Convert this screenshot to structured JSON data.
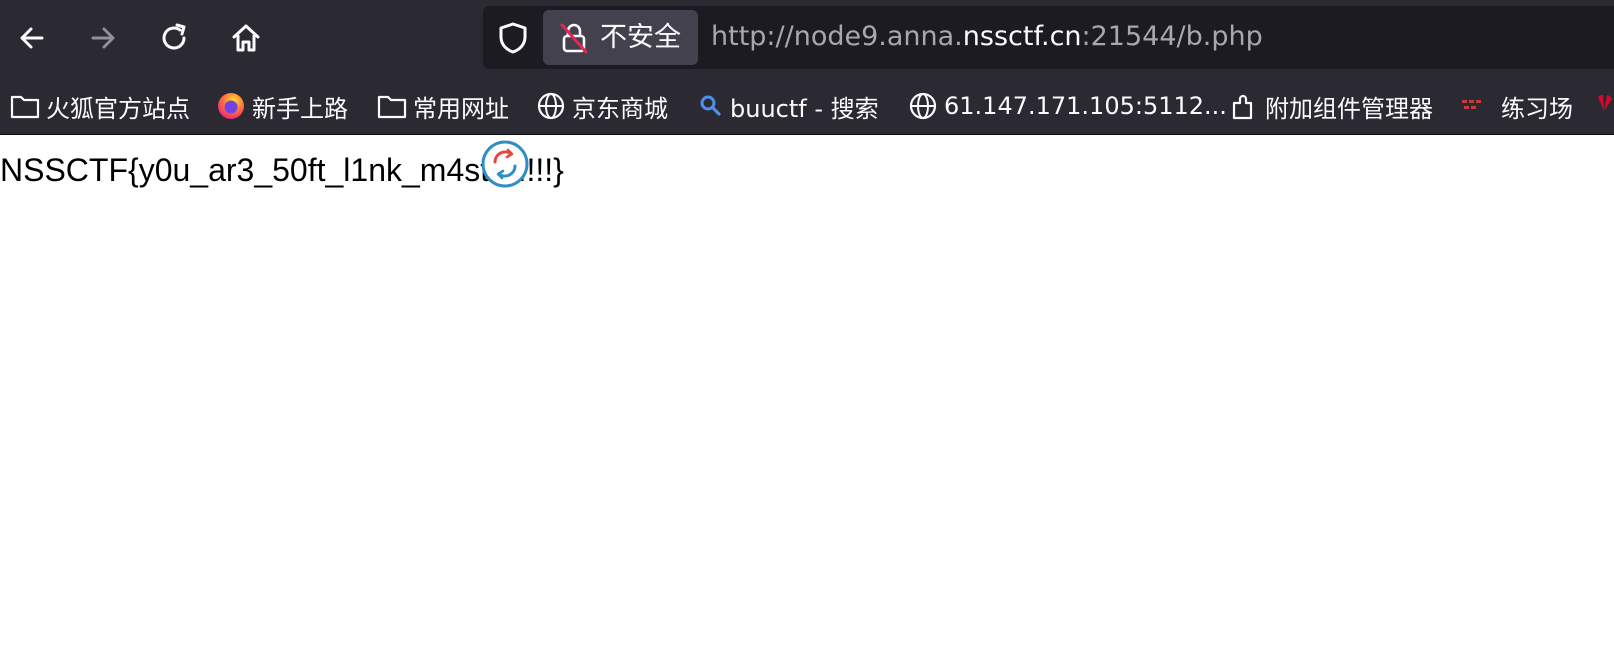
{
  "toolbar": {
    "back_icon": "arrow-left-icon",
    "forward_icon": "arrow-right-icon",
    "reload_icon": "reload-icon",
    "home_icon": "home-icon"
  },
  "urlbar": {
    "security_label": "不安全",
    "url_prefix": "http://node9.anna.",
    "url_domain": "nssctf.cn",
    "url_suffix": ":21544/b.php"
  },
  "bookmarks": [
    {
      "label": "火狐官方站点",
      "icon": "folder-icon"
    },
    {
      "label": "新手上路",
      "icon": "firefox-icon"
    },
    {
      "label": "常用网址",
      "icon": "folder-icon"
    },
    {
      "label": "京东商城",
      "icon": "globe-icon"
    },
    {
      "label": "buuctf - 搜索",
      "icon": "search-icon"
    },
    {
      "label": "61.147.171.105:5112...",
      "icon": "globe-icon"
    },
    {
      "label": "附加组件管理器",
      "icon": "puzzle-icon"
    },
    {
      "label": "练习场",
      "icon": "site-favicon-icon"
    }
  ],
  "page": {
    "flag_text": "NSSCTF{y0u_ar3_50ft_l1nk_m4st3r!!!!}"
  },
  "colors": {
    "chrome_bg": "#2b2a33",
    "urlbar_bg": "#1c1b22",
    "identity_bg": "#42414d",
    "text_light": "#fbfbfe",
    "text_dim": "#a8a7ae"
  }
}
